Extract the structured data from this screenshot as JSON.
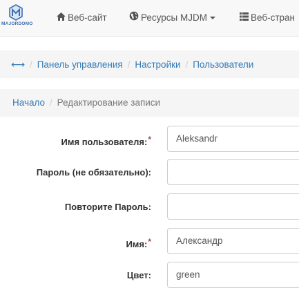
{
  "navbar": {
    "brand_text": "MAJORDOMO",
    "website_label": "Веб-сайт",
    "resources_label": "Ресурсы MJDM",
    "webpage_label": "Веб-стран"
  },
  "breadcrumb_main": {
    "items": [
      "Панель управления",
      "Настройки",
      "Пользователи"
    ]
  },
  "breadcrumb_sub": {
    "home": "Начало",
    "current": "Редактирование записи"
  },
  "form": {
    "username_label": "Имя пользователя:",
    "username_value": "Aleksandr",
    "password_label": "Пароль (не обязательно):",
    "password_value": "",
    "password_repeat_label": "Повторите Пароль:",
    "password_repeat_value": "",
    "name_label": "Имя:",
    "name_value": "Александр",
    "color_label": "Цвет:",
    "color_value": "green",
    "required_mark": "*"
  },
  "colors": {
    "link": "#337ab7",
    "required": "#a94442",
    "navbar_bg": "#f8f8f8",
    "breadcrumb_bg": "#f5f5f5"
  }
}
